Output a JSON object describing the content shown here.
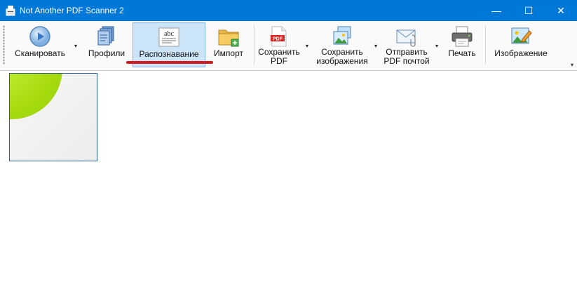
{
  "window": {
    "title": "Not Another PDF Scanner 2",
    "controls": {
      "minimize": "—",
      "maximize": "☐",
      "close": "✕"
    }
  },
  "toolbar": {
    "dropdown_glyph": "▾",
    "items": [
      {
        "id": "scan",
        "label": "Сканировать",
        "icon": "scan-play-icon",
        "has_dropdown": true
      },
      {
        "id": "profiles",
        "label": "Профили",
        "icon": "profiles-icon"
      },
      {
        "id": "ocr",
        "label": "Распознавание",
        "icon": "abc-ocr-icon",
        "active": true,
        "icon_text": "abc"
      },
      {
        "id": "import",
        "label": "Импорт",
        "icon": "folder-import-icon"
      },
      {
        "id": "save_pdf",
        "label_line1": "Сохранить",
        "label_line2": "PDF",
        "icon": "pdf-icon",
        "has_dropdown": true,
        "icon_text": "PDF"
      },
      {
        "id": "save_images",
        "label_line1": "Сохранить",
        "label_line2": "изображения",
        "icon": "images-icon",
        "has_dropdown": true
      },
      {
        "id": "email_pdf",
        "label_line1": "Отправить",
        "label_line2": "PDF почтой",
        "icon": "email-icon",
        "has_dropdown": true
      },
      {
        "id": "print",
        "label": "Печать",
        "icon": "printer-icon"
      },
      {
        "id": "image",
        "label": "Изображение",
        "icon": "image-edit-icon"
      }
    ],
    "overflow_glyph": "▾"
  },
  "colors": {
    "titlebar": "#0078d7",
    "active_button": "#cce4f7",
    "highlight_underline": "#d01b22",
    "thumbnail_border": "#2b5a8c"
  },
  "thumbnails": [
    {
      "id": "page-1",
      "selected": true
    }
  ]
}
